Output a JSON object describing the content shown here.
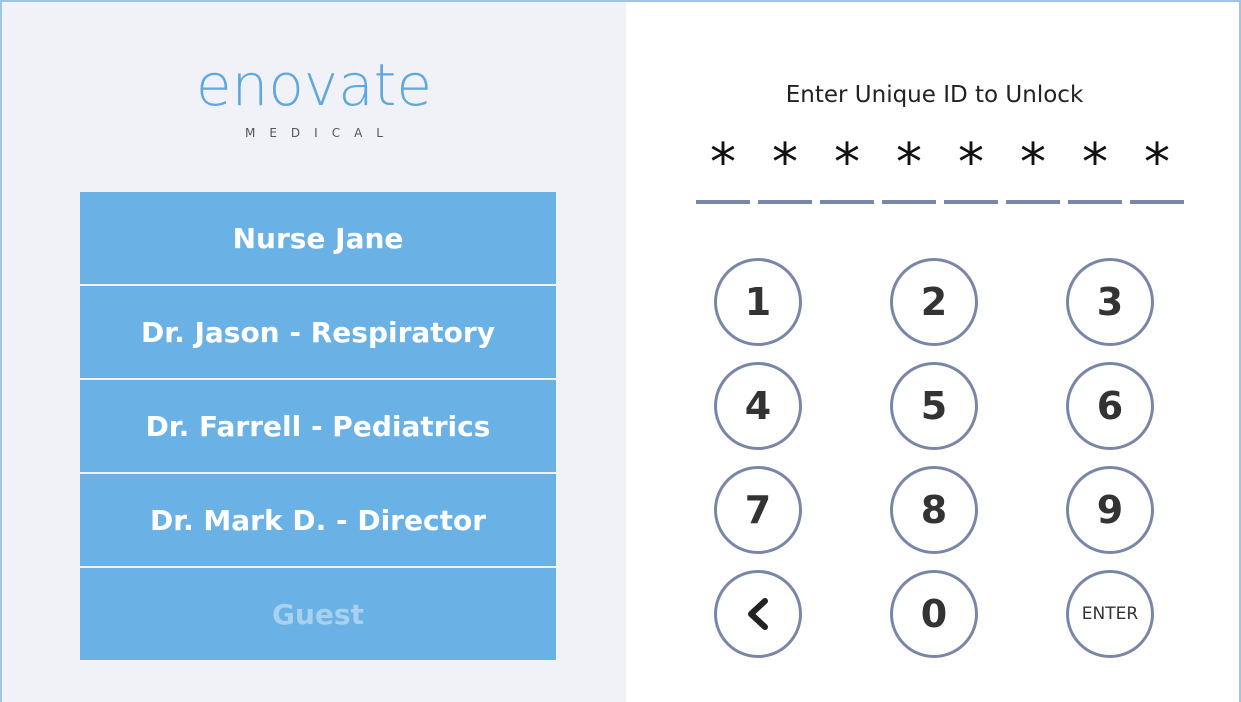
{
  "logo": {
    "wordmark": "enovate",
    "subtitle": "MEDICAL",
    "brand_color": "#5fa8de"
  },
  "users": [
    {
      "label": "Nurse Jane",
      "enabled": true
    },
    {
      "label": "Dr. Jason - Respiratory",
      "enabled": true
    },
    {
      "label": "Dr. Farrell - Pediatrics",
      "enabled": true
    },
    {
      "label": "Dr. Mark D. - Director",
      "enabled": true
    },
    {
      "label": "Guest",
      "enabled": false
    }
  ],
  "unlock": {
    "prompt": "Enter Unique ID to Unlock",
    "pin_chars": [
      "*",
      "*",
      "*",
      "*",
      "*",
      "*",
      "*",
      "*"
    ]
  },
  "keypad": {
    "keys": [
      "1",
      "2",
      "3",
      "4",
      "5",
      "6",
      "7",
      "8",
      "9",
      "back-icon",
      "0",
      "ENTER"
    ],
    "enter_label": "ENTER"
  },
  "colors": {
    "user_button_bg": "#6ab2e6",
    "left_panel_bg": "#f0f2f7",
    "keypad_border": "#7886a8",
    "disabled_text": "#a8d1ef"
  }
}
